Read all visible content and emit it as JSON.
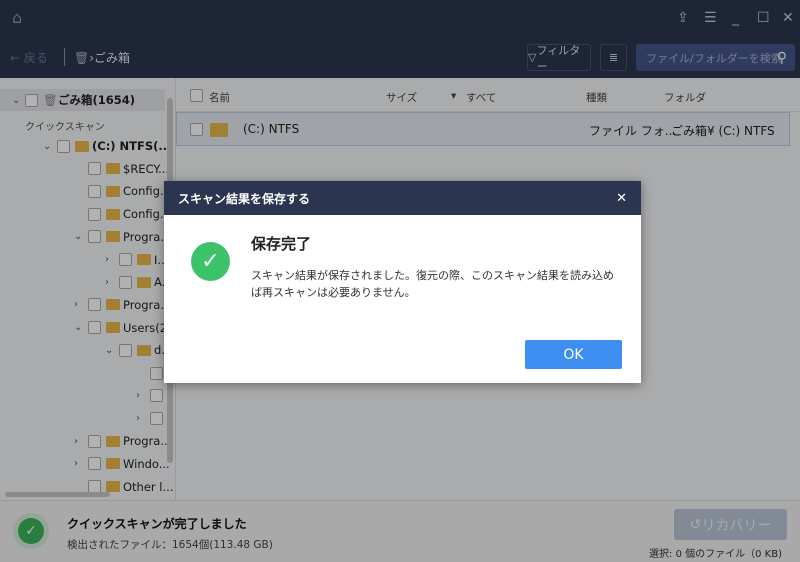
{
  "toolbar": {
    "back_label": "戻る",
    "breadcrumb": "ごみ箱",
    "filter_label": "フィルター",
    "search_placeholder": "ファイル/フォルダーを検索"
  },
  "sidebar": {
    "root_label": "ごみ箱(1654)",
    "section_label": "クイックスキャン",
    "items": [
      {
        "label": "(C:) NTFS(...",
        "level": 1,
        "chevron": "down"
      },
      {
        "label": "$RECY...",
        "level": 2,
        "chevron": ""
      },
      {
        "label": "Config...",
        "level": 2,
        "chevron": ""
      },
      {
        "label": "Config...",
        "level": 2,
        "chevron": ""
      },
      {
        "label": "Progra...",
        "level": 2,
        "chevron": "down"
      },
      {
        "label": "I...",
        "level": 3,
        "chevron": "right"
      },
      {
        "label": "A...",
        "level": 3,
        "chevron": "right"
      },
      {
        "label": "Progra...",
        "level": 2,
        "chevron": "right"
      },
      {
        "label": "Users(2...",
        "level": 2,
        "chevron": "down"
      },
      {
        "label": "d...",
        "level": 3,
        "chevron": "down"
      },
      {
        "label": "",
        "level": 4,
        "chevron": ""
      },
      {
        "label": "",
        "level": 4,
        "chevron": "right"
      },
      {
        "label": "",
        "level": 4,
        "chevron": "right"
      },
      {
        "label": "Progra...",
        "level": 2,
        "chevron": "right"
      },
      {
        "label": "Windo...",
        "level": 2,
        "chevron": "right"
      },
      {
        "label": "Other l...",
        "level": 2,
        "chevron": ""
      }
    ]
  },
  "table": {
    "columns": {
      "name": "名前",
      "size": "サイズ",
      "filter": "すべて",
      "type": "種類",
      "folder": "フォルダ"
    },
    "rows": [
      {
        "name": "(C:) NTFS",
        "type": "ファイル フォ...",
        "folder": "ごみ箱¥ (C:) NTFS"
      }
    ]
  },
  "footer": {
    "status_title": "クイックスキャンが完了しました",
    "status_detail": "検出されたファイル：1654個(113.48 GB)",
    "recover_label": "リカバリー",
    "selection": "選択: 0 個のファイル（0 KB)"
  },
  "dialog": {
    "title": "スキャン結果を保存する",
    "heading": "保存完了",
    "message": "スキャン結果が保存されました。復元の際、このスキャン結果を読み込めば再スキャンは必要ありません。",
    "ok_label": "OK"
  },
  "colors": {
    "accent": "#3d8ef0",
    "success": "#3cc36a",
    "header": "#2c3550"
  }
}
